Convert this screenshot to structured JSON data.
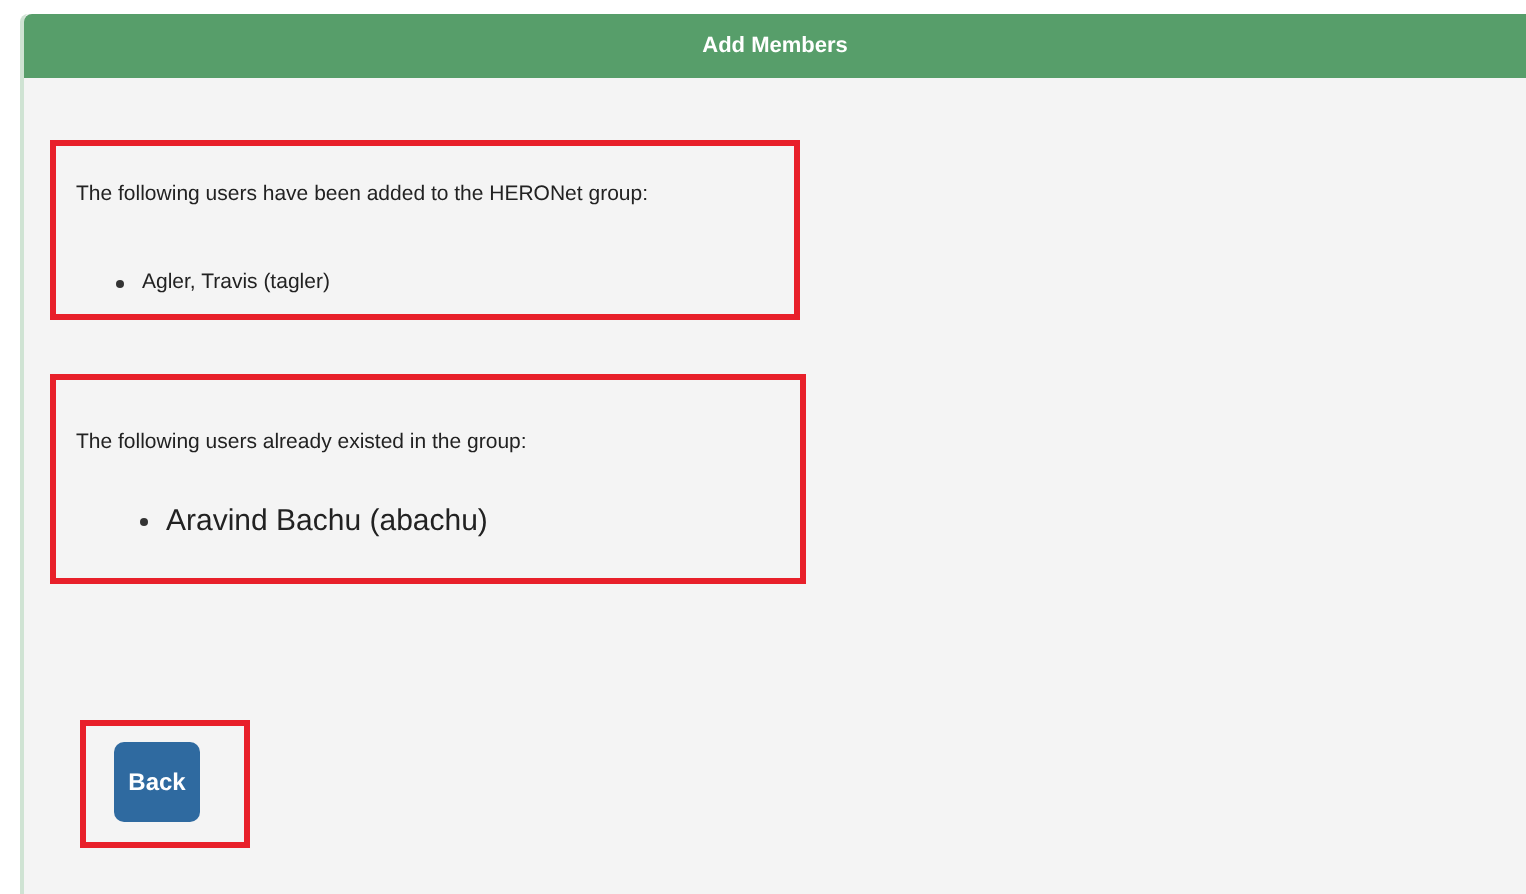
{
  "panel": {
    "title": "Add Members"
  },
  "sections": [
    {
      "kind": "small",
      "message": "The following users have been added to the HERONet group:",
      "users": [
        "Agler, Travis (tagler)"
      ]
    },
    {
      "kind": "large",
      "message": "The following users already existed in the group:",
      "users": [
        "Aravind Bachu (abachu)"
      ]
    }
  ],
  "buttons": [
    {
      "label": "Back"
    }
  ]
}
